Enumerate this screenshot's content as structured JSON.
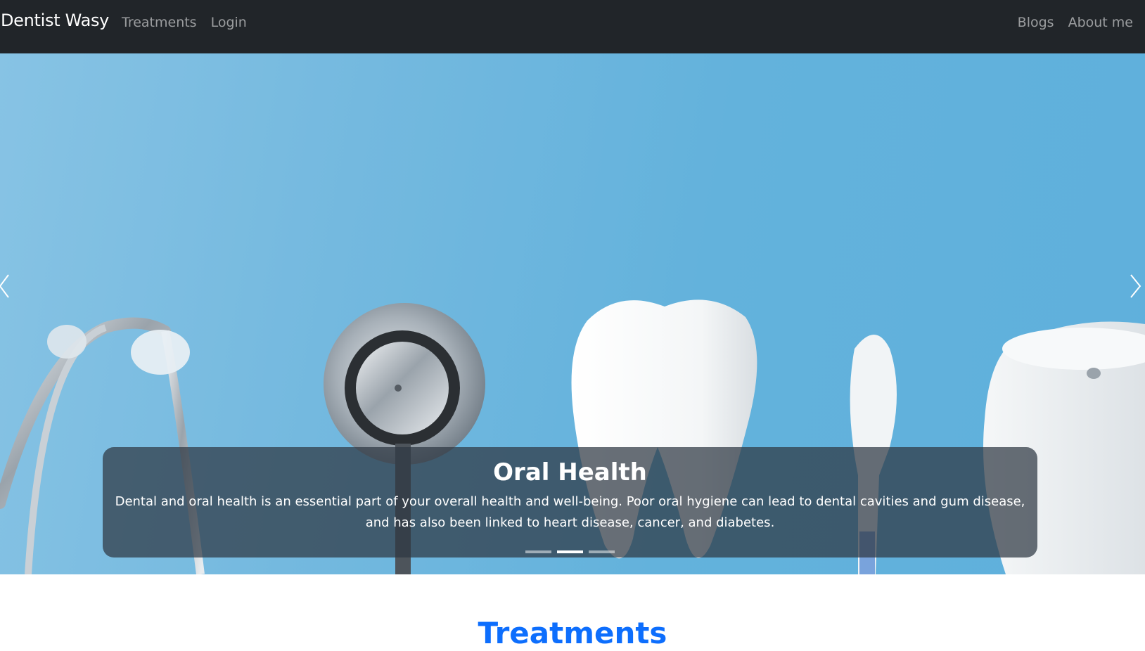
{
  "navbar": {
    "brand": "Dentist Wasy",
    "left_links": [
      "Treatments",
      "Login"
    ],
    "right_links": [
      "Blogs",
      "About me"
    ]
  },
  "carousel": {
    "caption_title": "Oral Health",
    "caption_text": "Dental and oral health is an essential part of your overall health and well-being. Poor oral hygiene can lead to dental cavities and gum disease, and has also been linked to heart disease, cancer, and diabetes.",
    "slide_count": 3,
    "active_index": 1,
    "prev_icon": "chevron-left-icon",
    "next_icon": "chevron-right-icon"
  },
  "sections": {
    "treatments_title": "Treatments"
  },
  "colors": {
    "navbar_bg": "#212529",
    "hero_bg": "#63b2dc",
    "accent": "#0d6efd"
  }
}
